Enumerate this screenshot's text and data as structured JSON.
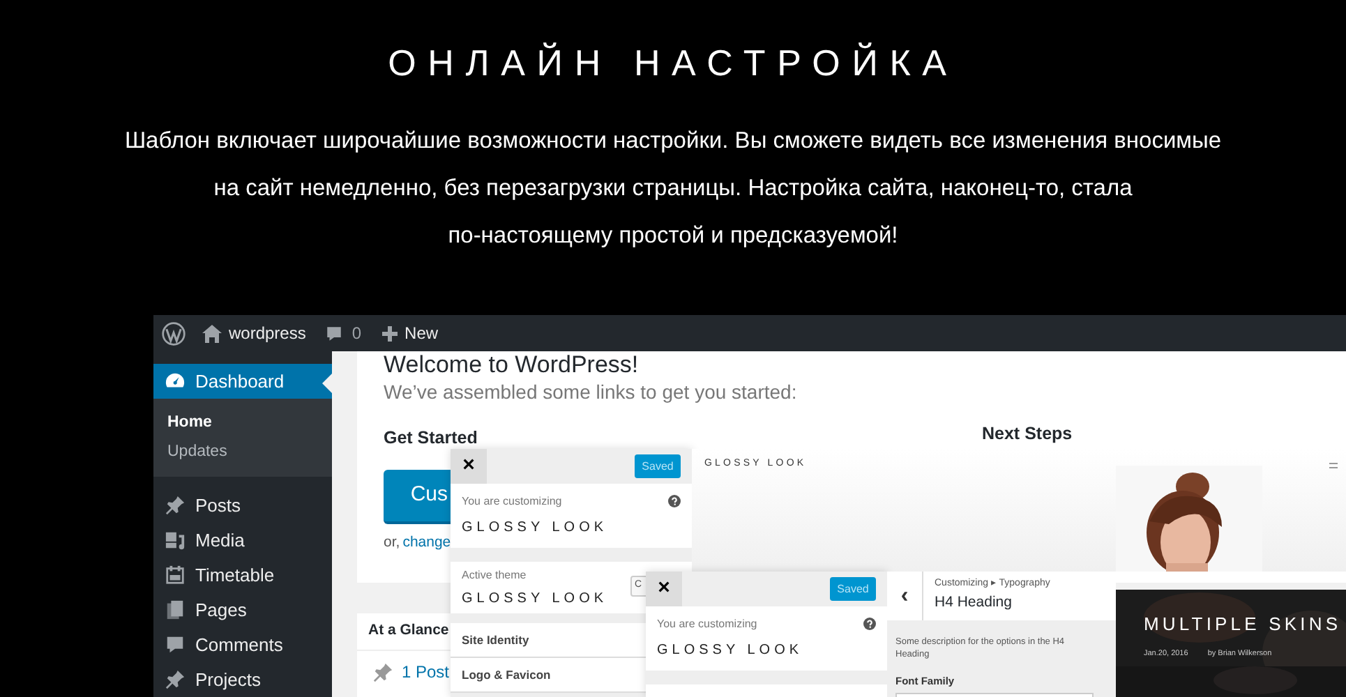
{
  "heading": "ОНЛАЙН НАСТРОЙКА",
  "description_lines": [
    "Шаблон включает широчайшие возможности настройки. Вы сможете видеть все изменения вносимые",
    "на сайт немедленно, без перезагрузки страницы. Настройка сайта, наконец-то, стала",
    "по-настоящему простой и предсказуемой!"
  ],
  "admin_bar": {
    "site": "wordpress",
    "comments": "0",
    "new": "New"
  },
  "sidebar": {
    "items": [
      {
        "label": "Dashboard",
        "selected": true,
        "children": [
          {
            "label": "Home",
            "selected": true
          },
          {
            "label": "Updates",
            "selected": false
          }
        ]
      },
      {
        "label": "Posts",
        "selected": false
      },
      {
        "label": "Media",
        "selected": false
      },
      {
        "label": "Timetable",
        "selected": false
      },
      {
        "label": "Pages",
        "selected": false
      },
      {
        "label": "Comments",
        "selected": false
      },
      {
        "label": "Projects",
        "selected": false
      }
    ]
  },
  "welcome": {
    "title": "Welcome to WordPress!",
    "subtitle": "We’ve assembled some links to get you started:",
    "get_started": "Get Started",
    "button": "Cus",
    "or_text": "or,",
    "link": "change",
    "next_steps": "Next Steps"
  },
  "glance": {
    "title": "At a Glance",
    "posts": "1 Post"
  },
  "customizer_1": {
    "close": "×",
    "saved": "Saved",
    "customizing_label": "You are customizing",
    "theme_name": "GLOSSY LOOK",
    "active_label": "Active theme",
    "active_name": "GLOSSY LOOK",
    "change_button": "C",
    "sections": [
      "Site Identity",
      "Logo & Favicon"
    ]
  },
  "preview": {
    "logo": "GLOSSY LOOK"
  },
  "customizer_2": {
    "close": "×",
    "saved": "Saved",
    "customizing_label": "You are customizing",
    "theme_name": "GLOSSY LOOK"
  },
  "typography": {
    "back": "‹",
    "breadcrumb": "Customizing ▸ Typography",
    "title": "H4 Heading",
    "description": "Some description for the options in the H4 Heading",
    "font_family_label": "Font Family"
  },
  "skin_preview": {
    "title": "MULTIPLE SKINS",
    "date": "Jan.20, 2016",
    "author": "by Brian Wilkerson"
  }
}
